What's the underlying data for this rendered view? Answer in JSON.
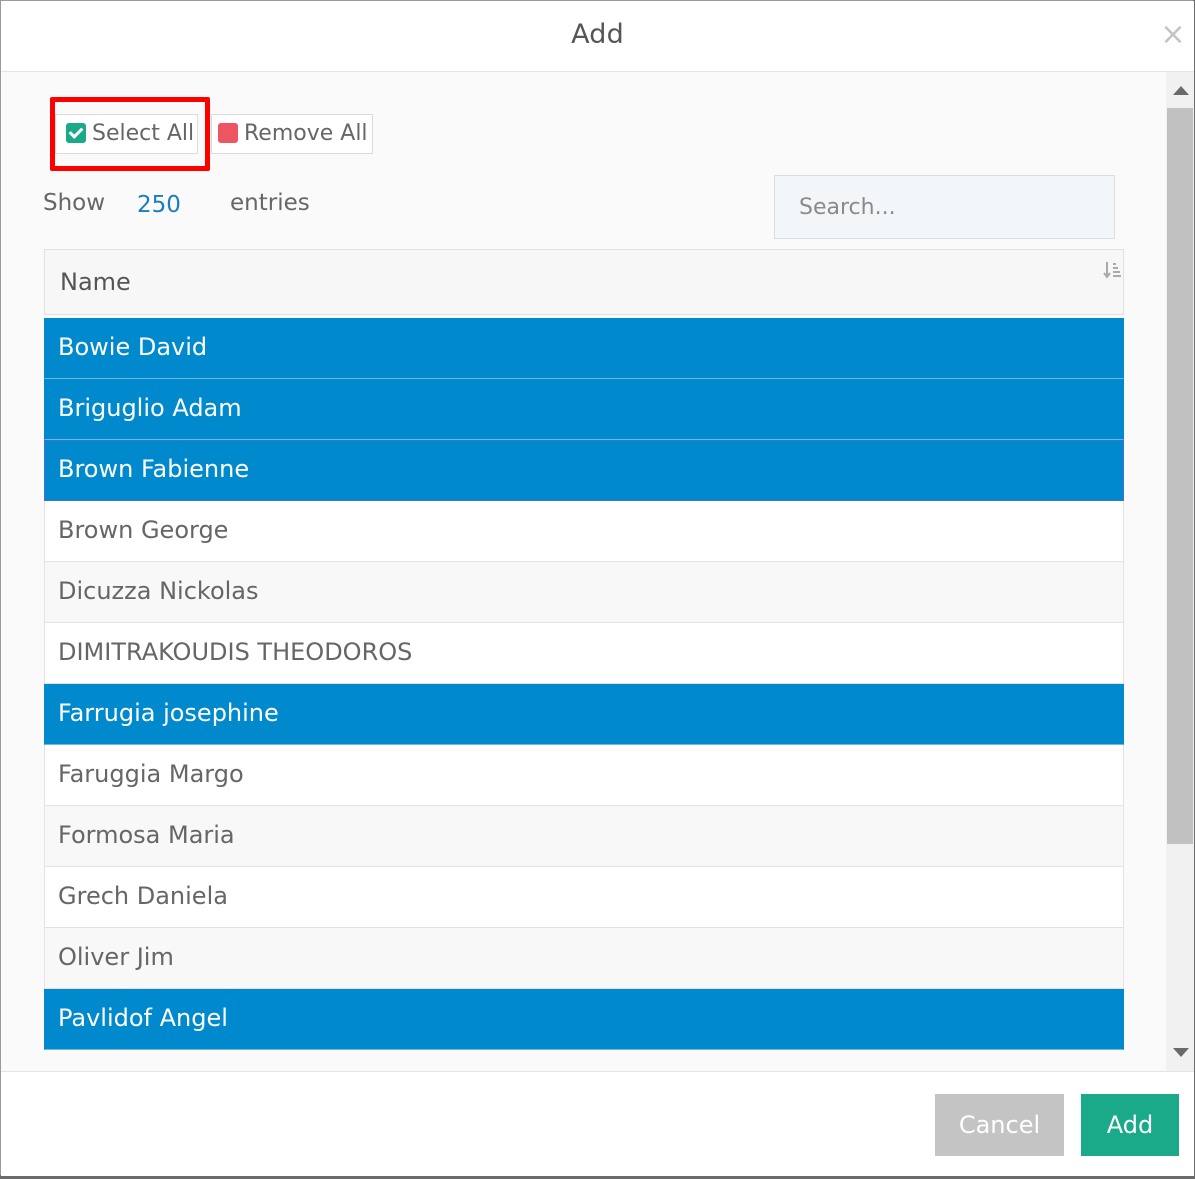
{
  "modal": {
    "title": "Add",
    "close_glyph": "×"
  },
  "toolbar": {
    "select_all_label": "Select All",
    "remove_all_label": "Remove All"
  },
  "length": {
    "show_label": "Show",
    "value": "250",
    "entries_label": "entries"
  },
  "search": {
    "placeholder": "Search...",
    "value": ""
  },
  "table": {
    "columns": [
      "Name"
    ],
    "rows": [
      {
        "name": "Bowie David",
        "selected": true
      },
      {
        "name": "Briguglio Adam",
        "selected": true
      },
      {
        "name": "Brown Fabienne",
        "selected": true
      },
      {
        "name": "Brown George",
        "selected": false
      },
      {
        "name": "Dicuzza Nickolas",
        "selected": false
      },
      {
        "name": "DIMITRAKOUDIS THEODOROS",
        "selected": false
      },
      {
        "name": "Farrugia josephine",
        "selected": true
      },
      {
        "name": "Faruggia Margo",
        "selected": false
      },
      {
        "name": "Formosa Maria",
        "selected": false
      },
      {
        "name": "Grech Daniela",
        "selected": false
      },
      {
        "name": "Oliver Jim",
        "selected": false
      },
      {
        "name": "Pavlidof Angel",
        "selected": true
      }
    ]
  },
  "footer": {
    "cancel_label": "Cancel",
    "add_label": "Add"
  },
  "colors": {
    "selected_row": "#0089cc",
    "primary_green": "#1aaa8a",
    "danger_red": "#ee5563",
    "highlight_red": "#ff0000",
    "cancel_grey": "#c4c4c4"
  },
  "icons": {
    "close": "close-icon",
    "select_all": "checkbox-checked-icon",
    "remove_all": "square-remove-icon",
    "sort": "sort-icon"
  }
}
